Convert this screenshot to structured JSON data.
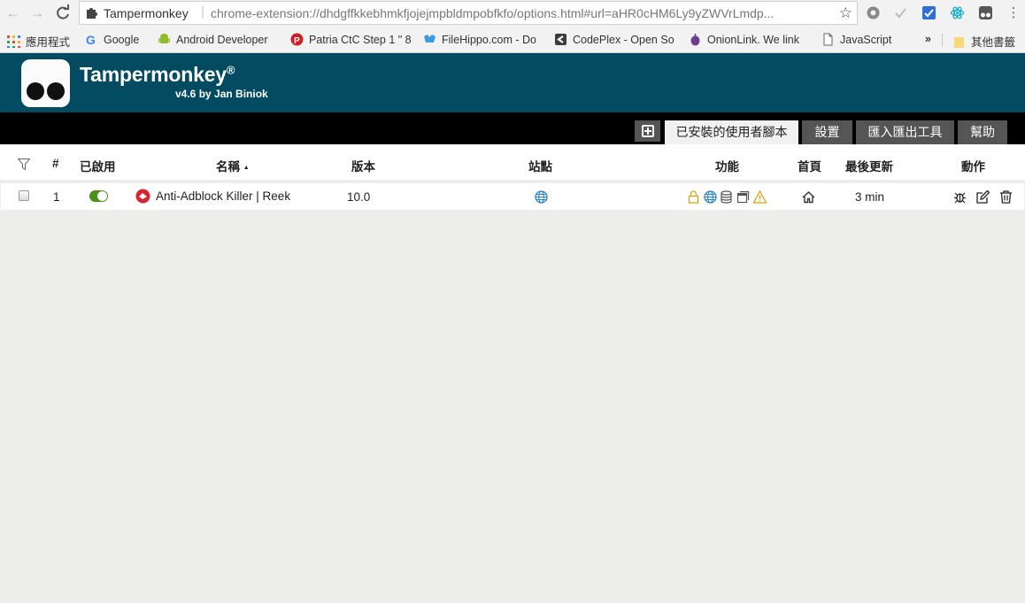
{
  "browser": {
    "tab_name": "Tampermonkey",
    "url": "chrome-extension://dhdgffkkebhmkfjojejmpbldmpobfkfo/options.html#url=aHR0cHM6Ly9yZWVrLmdp...",
    "bookmarks": [
      {
        "label": "應用程式",
        "icon": "apps-grid-icon"
      },
      {
        "label": "Google",
        "icon": "google-icon"
      },
      {
        "label": "Android Developer",
        "icon": "android-icon"
      },
      {
        "label": "Patria CtC Step 1 \" 8",
        "icon": "pinterest-icon"
      },
      {
        "label": "FileHippo.com - Do",
        "icon": "filehippo-icon"
      },
      {
        "label": "CodePlex - Open So",
        "icon": "codeplex-icon"
      },
      {
        "label": "OnionLink. We link",
        "icon": "onion-icon"
      },
      {
        "label": "JavaScript",
        "icon": "page-icon"
      }
    ],
    "overflow": "»",
    "other_bookmarks": "其他書籤"
  },
  "header": {
    "title": "Tampermonkey",
    "registered": "®",
    "version": "v4.6 by Jan Biniok",
    "color": "#024b61"
  },
  "tabs": [
    {
      "label": "已安裝的使用者腳本",
      "active": true
    },
    {
      "label": "設置",
      "active": false
    },
    {
      "label": "匯入匯出工具",
      "active": false
    },
    {
      "label": "幫助",
      "active": false
    }
  ],
  "table": {
    "headers": {
      "num": "#",
      "enabled": "已啟用",
      "name": "名稱",
      "sort_indicator": "▲",
      "version": "版本",
      "sites": "站點",
      "features": "功能",
      "homepage": "首頁",
      "updated": "最後更新",
      "actions": "動作"
    },
    "rows": [
      {
        "num": "1",
        "enabled": true,
        "name": "Anti-Adblock Killer | Reek",
        "version": "10.0",
        "site_icon": "globe-icon",
        "features": [
          "lock-icon",
          "globe-icon",
          "database-icon",
          "window-icon",
          "warning-icon"
        ],
        "homepage_icon": "home-icon",
        "updated": "3 min",
        "actions": [
          "bug-icon",
          "edit-icon",
          "trash-icon"
        ]
      }
    ]
  }
}
